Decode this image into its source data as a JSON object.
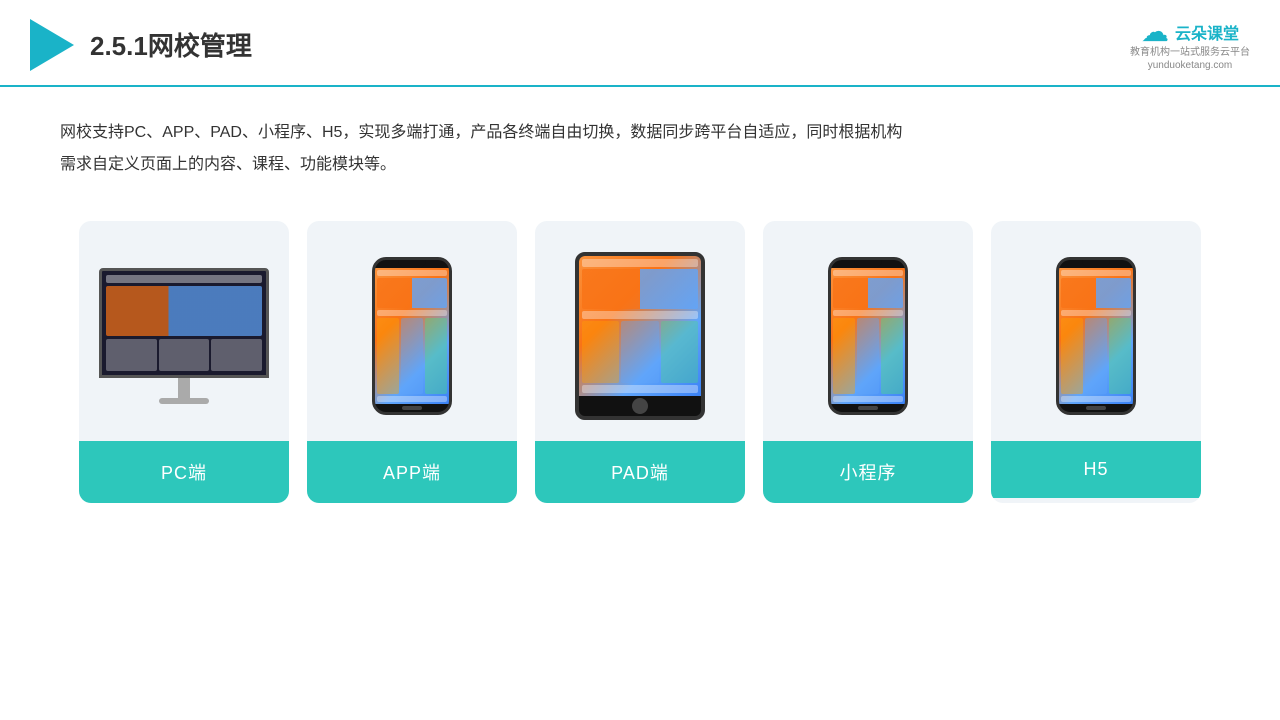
{
  "header": {
    "title": "2.5.1网校管理",
    "brand": {
      "name_cn": "云朵课堂",
      "tagline": "教育机构一站\n式服务云平台",
      "url": "yunduoketang.com"
    }
  },
  "description": {
    "text": "网校支持PC、APP、PAD、小程序、H5，实现多端打通，产品各终端自由切换，数据同步跨平台自适应，同时根据机构需求自定义页面上的内容、课程、功能模块等。"
  },
  "cards": [
    {
      "id": "pc",
      "label": "PC端"
    },
    {
      "id": "app",
      "label": "APP端"
    },
    {
      "id": "pad",
      "label": "PAD端"
    },
    {
      "id": "miniprogram",
      "label": "小程序"
    },
    {
      "id": "h5",
      "label": "H5"
    }
  ]
}
